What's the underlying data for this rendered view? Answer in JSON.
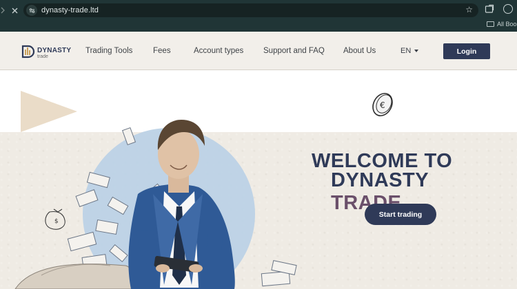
{
  "browser": {
    "url": "dynasty-trade.ltd",
    "bookmarks_label": "All Bookm",
    "icons": {
      "back": "chevron-right-icon",
      "close": "close-icon",
      "site_info": "site-info-icon",
      "bookmark": "star-icon",
      "extensions": "extension-icon",
      "profile": "profile-icon",
      "folder": "folder-icon"
    }
  },
  "header": {
    "logo_title": "DYNASTY",
    "logo_subtitle": "trade",
    "nav": [
      "Trading Tools",
      "Fees",
      "Account types",
      "Support and FAQ",
      "About Us"
    ],
    "language": "EN",
    "login_label": "Login"
  },
  "hero": {
    "title_line1": "WELCOME TO",
    "title_line2_part1": "DYNASTY",
    "title_line2_part2": "TRADE",
    "cta_label": "Start trading"
  },
  "colors": {
    "brand_dark": "#2f3a58",
    "brand_accent": "#6a4f6a",
    "header_bg": "#f2efea",
    "paper_bg": "#efebe4",
    "illustration_blue": "#bcd2e6"
  }
}
